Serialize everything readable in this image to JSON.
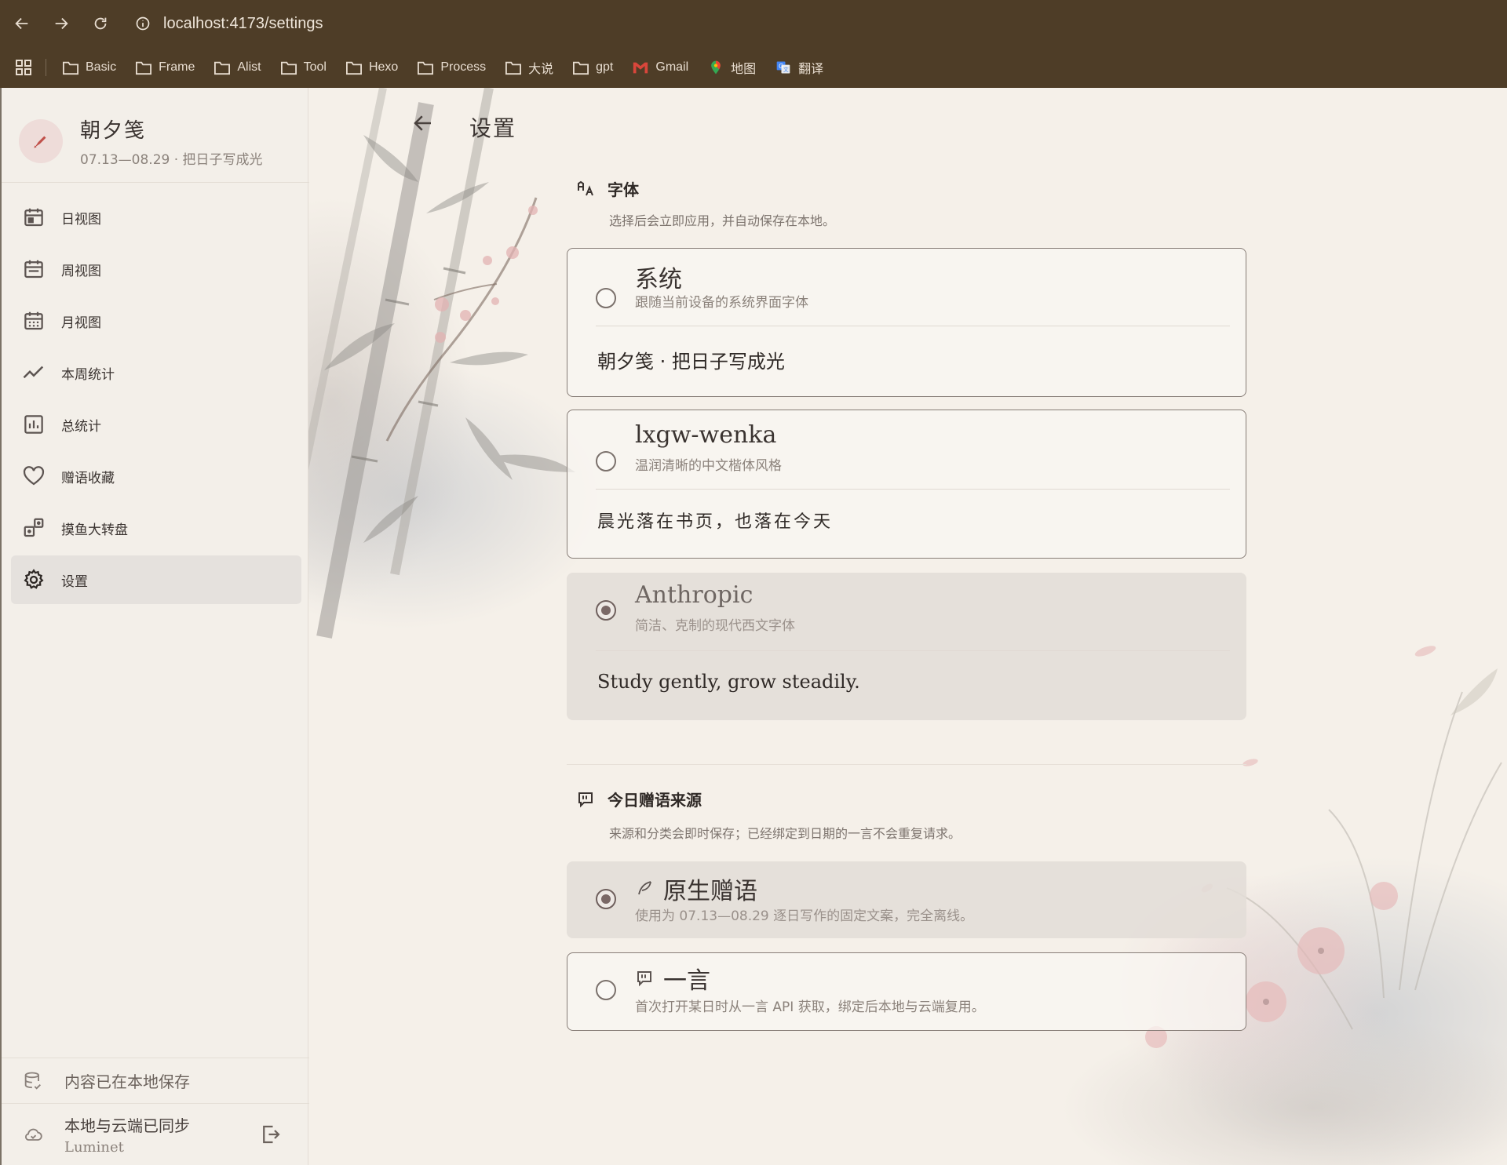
{
  "browser": {
    "url": "localhost:4173/settings",
    "bookmarks": [
      {
        "label": "Basic",
        "icon": "folder-icon"
      },
      {
        "label": "Frame",
        "icon": "folder-icon"
      },
      {
        "label": "Alist",
        "icon": "folder-icon"
      },
      {
        "label": "Tool",
        "icon": "folder-icon"
      },
      {
        "label": "Hexo",
        "icon": "folder-icon"
      },
      {
        "label": "Process",
        "icon": "folder-icon"
      },
      {
        "label": "大说",
        "icon": "folder-icon"
      },
      {
        "label": "gpt",
        "icon": "folder-icon"
      },
      {
        "label": "Gmail",
        "icon": "gmail-icon"
      },
      {
        "label": "地图",
        "icon": "maps-pin-icon"
      },
      {
        "label": "翻译",
        "icon": "translate-icon"
      }
    ]
  },
  "sidebar": {
    "brand_title": "朝夕笺",
    "brand_subtitle": "07.13—08.29 · 把日子写成光",
    "items": [
      {
        "label": "日视图",
        "icon": "calendar-day-icon"
      },
      {
        "label": "周视图",
        "icon": "calendar-week-icon"
      },
      {
        "label": "月视图",
        "icon": "calendar-month-icon"
      },
      {
        "label": "本周统计",
        "icon": "trend-line-icon"
      },
      {
        "label": "总统计",
        "icon": "bar-chart-icon"
      },
      {
        "label": "赠语收藏",
        "icon": "heart-icon"
      },
      {
        "label": "摸鱼大转盘",
        "icon": "dice-icon"
      },
      {
        "label": "设置",
        "icon": "gear-icon",
        "active": true
      }
    ],
    "local_status": "内容已在本地保存",
    "sync_status": "本地与云端已同步",
    "sync_user": "Luminet"
  },
  "main": {
    "title": "设置",
    "font_section": {
      "title": "字体",
      "description": "选择后会立即应用，并自动保存在本地。",
      "options": [
        {
          "name": "系统",
          "description": "跟随当前设备的系统界面字体",
          "preview": "朝夕笺 · 把日子写成光",
          "selected": false
        },
        {
          "name": "lxgw-wenka",
          "description": "温润清晰的中文楷体风格",
          "preview": "晨光落在书页，也落在今天",
          "selected": false
        },
        {
          "name": "Anthropic",
          "description": "简洁、克制的现代西文字体",
          "preview": "Study gently, grow steadily.",
          "selected": true
        }
      ]
    },
    "quote_section": {
      "title": "今日赠语来源",
      "description": "来源和分类会即时保存；已经绑定到日期的一言不会重复请求。",
      "options": [
        {
          "name": "原生赠语",
          "icon": "feather-icon",
          "description": "使用为 07.13—08.29 逐日写作的固定文案，完全离线。",
          "selected": true
        },
        {
          "name": "一言",
          "icon": "quote-bubble-icon",
          "description": "首次打开某日时从一言 API 获取，绑定后本地与云端复用。",
          "selected": false
        }
      ]
    }
  },
  "colors": {
    "browser_chrome": "#4e3d27",
    "page_background": "#f5f0e9",
    "accent_radio": "#7a6866",
    "brand_pen": "#c0504a"
  }
}
